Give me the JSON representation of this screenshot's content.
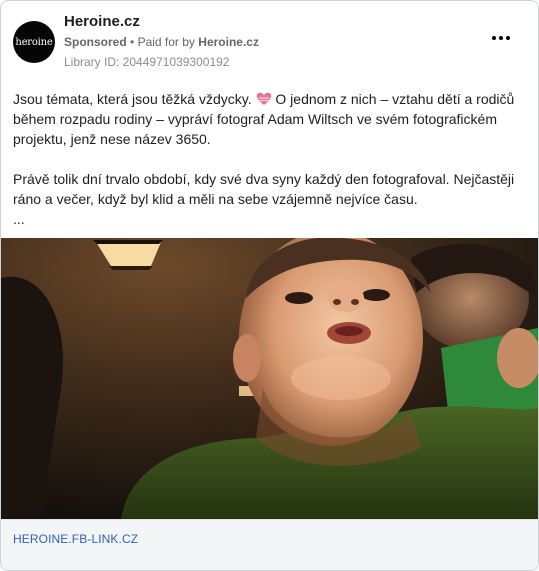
{
  "advertiser": {
    "name": "Heroine.cz",
    "avatar_text": "heroine",
    "sponsored_label": "Sponsored",
    "paid_for_prefix": "Paid for by",
    "paid_for_name": "Heroine.cz",
    "library_id": "Library ID: 2044971039300192"
  },
  "post": {
    "line1_before_icon": "Jsou témata, která jsou těžká vždycky.",
    "line1_after_icon": "O jednom z nich – vztahu dětí a rodičů během rozpadu rodiny – vypráví fotograf Adam Wiltsch ve svém fotografickém projektu, jenž nese název 3650.",
    "paragraph2": "Právě tolik dní trvalo období, kdy své dva syny každý den fotografoval. Nejčastěji ráno a večer, když byl klid a měli na sebe vzájemně nejvíce času.",
    "ellipsis": "...",
    "inline_icon": "heart-emoji-icon"
  },
  "footer": {
    "link_text": "HEROINE.FB-LINK.CZ"
  },
  "colors": {
    "link": "#2f62b8",
    "heart": "#e8729a",
    "shirt": "#3f5a1e"
  }
}
